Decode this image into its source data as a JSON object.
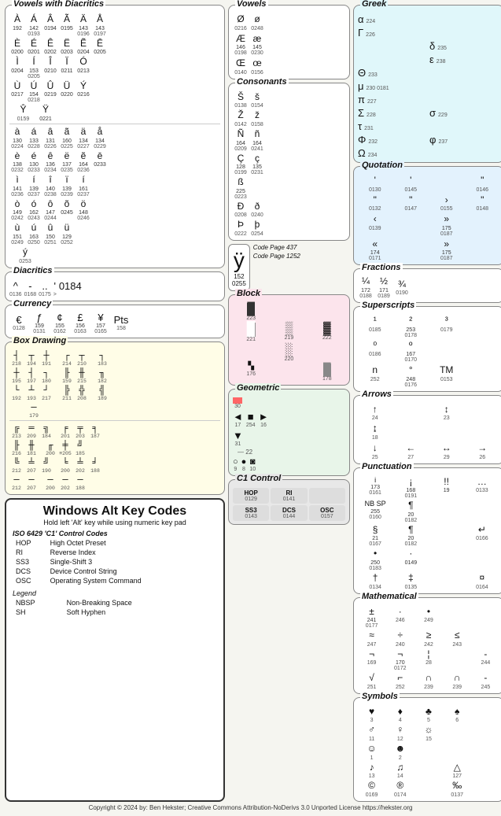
{
  "page": {
    "title": "Windows Alt Key Codes",
    "subtitle": "Hold left 'Alt' key while using numeric key pad",
    "copyright": "Copyright © 2024 by: Ben Hekster; Creative Commons Attribution-NoDerivs 3.0 Unported License https://hekster.org"
  },
  "sections": {
    "vowels_diacritics": {
      "label": "Vowels with Diacritics"
    },
    "vowels": {
      "label": "Vowels"
    },
    "greek": {
      "label": "Greek"
    },
    "quotation": {
      "label": "Quotation"
    },
    "consonants": {
      "label": "Consonants"
    },
    "fractions": {
      "label": "Fractions"
    },
    "superscripts": {
      "label": "Superscripts"
    },
    "diacritics": {
      "label": "Diacritics"
    },
    "currency": {
      "label": "Currency"
    },
    "arrows": {
      "label": "Arrows"
    },
    "box_drawing": {
      "label": "Box Drawing"
    },
    "block": {
      "label": "Block"
    },
    "punctuation": {
      "label": "Punctuation"
    },
    "geometric": {
      "label": "Geometric"
    },
    "mathematical": {
      "label": "Mathematical"
    },
    "c1_control": {
      "label": "C1 Control"
    },
    "symbols": {
      "label": "Symbols"
    }
  },
  "control_codes": {
    "title": "ISO 6429 'C1' Control Codes",
    "items": [
      {
        "code": "HOP",
        "desc": "High Octet Preset"
      },
      {
        "code": "RI",
        "desc": "Reverse Index"
      },
      {
        "code": "SS3",
        "desc": "Single-Shift 3"
      },
      {
        "code": "DCS",
        "desc": "Device Control String"
      },
      {
        "code": "OSC",
        "desc": "Operating System Command"
      }
    ]
  },
  "legend": {
    "label": "Legend",
    "items": [
      {
        "code": "NBSP",
        "desc": "Non-Breaking Space"
      },
      {
        "code": "SH",
        "desc": "Soft Hyphen"
      }
    ]
  },
  "codepage": {
    "code437": "Code Page 437",
    "code1252": "Code Page 1252"
  }
}
